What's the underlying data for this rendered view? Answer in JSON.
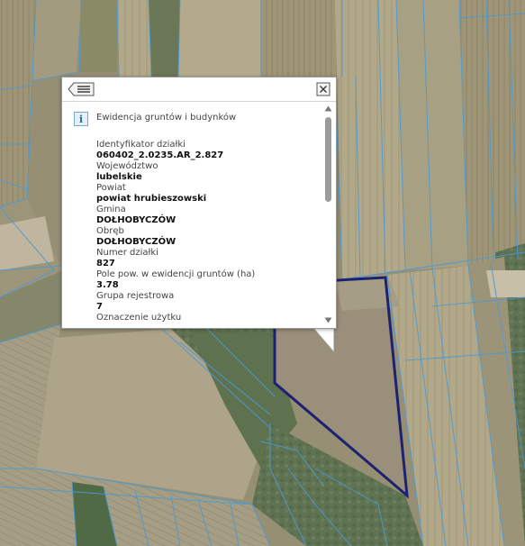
{
  "map": {
    "colors": {
      "parcel_lines": "#4a9ad6",
      "selected_parcel": "#1c2271"
    }
  },
  "popup": {
    "header": {
      "list_icon": "list-back-icon",
      "close_icon": "close-icon"
    },
    "info_icon_glyph": "i",
    "layer_title": "Ewidencja gruntów i budynków",
    "attributes": [
      {
        "label": "Identyfikator działki",
        "value": "060402_2.0235.AR_2.827"
      },
      {
        "label": "Województwo",
        "value": "lubelskie"
      },
      {
        "label": "Powiat",
        "value": "powiat hrubieszowski"
      },
      {
        "label": "Gmina",
        "value": "DOŁHOBYCZÓW"
      },
      {
        "label": "Obręb",
        "value": "DOŁHOBYCZÓW"
      },
      {
        "label": "Numer działki",
        "value": "827"
      },
      {
        "label": "Pole pow. w ewidencji gruntów (ha)",
        "value": "3.78"
      },
      {
        "label": "Grupa rejestrowa",
        "value": "7"
      },
      {
        "label": "Oznaczenie użytku",
        "value": ""
      }
    ]
  }
}
